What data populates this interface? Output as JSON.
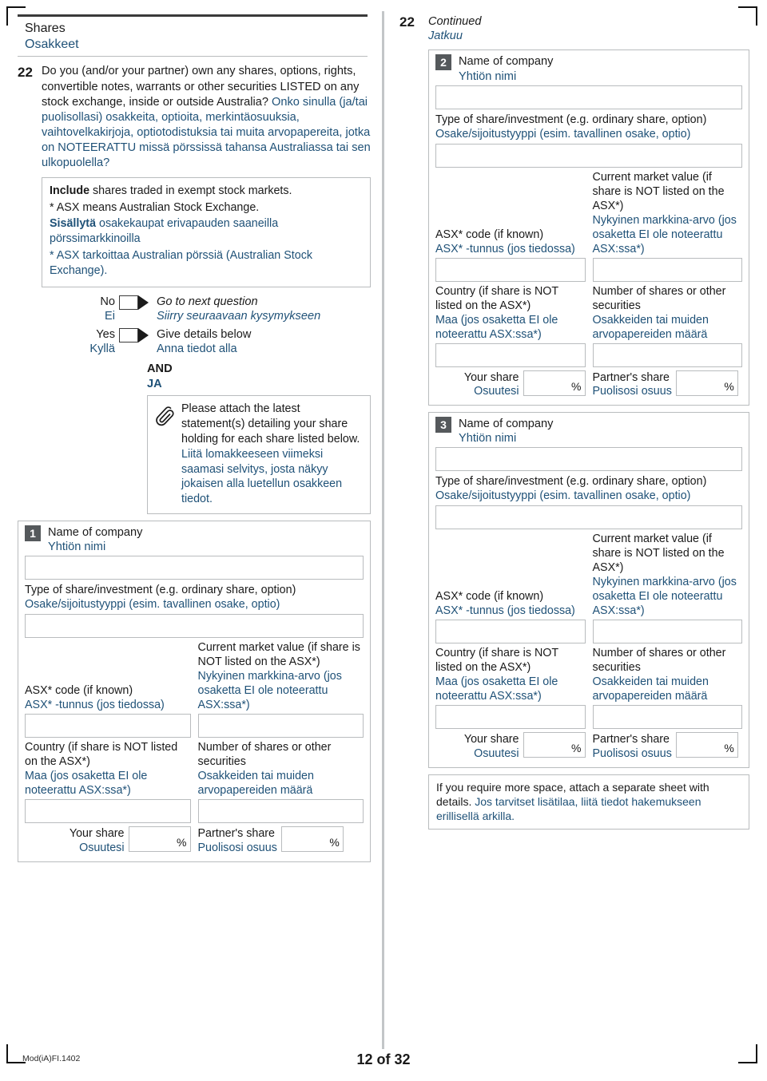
{
  "section": {
    "title_en": "Shares",
    "title_fi": "Osakkeet"
  },
  "question": {
    "number": "22",
    "text_en": "Do you (and/or your partner) own any shares, options, rights, convertible notes, warrants or other securities LISTED on any stock exchange, inside or outside Australia?",
    "text_fi": "Onko sinulla (ja/tai puolisollasi) osakkeita, optioita, merkintäosuuksia, vaihtovelkakirjoja, optiotodistuksia tai muita arvopapereita, jotka on NOTEERATTU missä pörssissä tahansa Australiassa tai sen ulkopuolella?"
  },
  "infobox": {
    "include_bold_en": "Include",
    "include_rest_en": " shares traded in exempt stock markets.",
    "asx_note_en": "* ASX means Australian Stock Exchange.",
    "include_bold_fi": "Sisällytä",
    "include_rest_fi": " osakekaupat erivapauden saaneilla pörssimarkkinoilla",
    "asx_note_fi": "* ASX tarkoittaa Australian pörssiä (Australian Stock Exchange)."
  },
  "answers": {
    "no_en": "No",
    "no_fi": "Ei",
    "no_action_en": "Go to next question",
    "no_action_fi": "Siirry seuraavaan kysymykseen",
    "yes_en": "Yes",
    "yes_fi": "Kyllä",
    "yes_action_en": "Give details below",
    "yes_action_fi": "Anna tiedot alla",
    "and_en": "AND",
    "and_fi": "JA"
  },
  "attach_note": {
    "icon": "paperclip-icon",
    "text_en": "Please attach the latest statement(s) detailing your share holding for each share listed below.",
    "text_fi": "Liitä lomakkeeseen viimeksi saamasi selvitys, josta näkyy jokaisen alla luetellun osakkeen tiedot."
  },
  "labels": {
    "company_en": "Name of company",
    "company_fi": "Yhtiön nimi",
    "type_en": "Type of share/investment (e.g. ordinary share, option)",
    "type_fi": "Osake/sijoitustyyppi (esim. tavallinen osake, optio)",
    "asx_code_en": "ASX* code (if known)",
    "asx_code_fi": "ASX* -tunnus (jos tiedossa)",
    "market_value_en": "Current market value (if share is NOT listed on the ASX*)",
    "market_value_fi": "Nykyinen markkina-arvo (jos osaketta EI ole noteerattu ASX:ssa*)",
    "country_en": "Country (if share is NOT listed on the ASX*)",
    "country_fi": "Maa (jos osaketta EI ole noteerattu ASX:ssa*)",
    "number_shares_en": "Number of shares or other securities",
    "number_shares_fi": "Osakkeiden tai muiden arvopapereiden määrä",
    "your_share_en": "Your share",
    "your_share_fi": "Osuutesi",
    "partner_share_en": "Partner's share",
    "partner_share_fi": "Puolisosi osuus",
    "percent_symbol": "%"
  },
  "entries": [
    {
      "number": "1",
      "company_value": "",
      "type_value": "",
      "asx_code_value": "",
      "market_value_value": "",
      "country_value": "",
      "number_shares_value": "",
      "your_share_value": "",
      "partner_share_value": ""
    },
    {
      "number": "2",
      "company_value": "",
      "type_value": "",
      "asx_code_value": "",
      "market_value_value": "",
      "country_value": "",
      "number_shares_value": "",
      "your_share_value": "",
      "partner_share_value": ""
    },
    {
      "number": "3",
      "company_value": "",
      "type_value": "",
      "asx_code_value": "",
      "market_value_value": "",
      "country_value": "",
      "number_shares_value": "",
      "your_share_value": "",
      "partner_share_value": ""
    }
  ],
  "continued": {
    "number": "22",
    "text_en": "Continued",
    "text_fi": "Jatkuu"
  },
  "more_space": {
    "text_en": "If you require more space, attach a separate sheet with details.",
    "text_fi": "Jos tarvitset lisätilaa, liitä tiedot hakemukseen erillisellä arkilla."
  },
  "footer": {
    "form_code": "Mod(iA)FI.1402",
    "page_label": "12 of 32"
  },
  "colors": {
    "finnish_text": "#205278",
    "english_text": "#1a1a1a",
    "border": "#b9bcbe",
    "badge": "#55595c",
    "rule": "#3a3a3a"
  }
}
